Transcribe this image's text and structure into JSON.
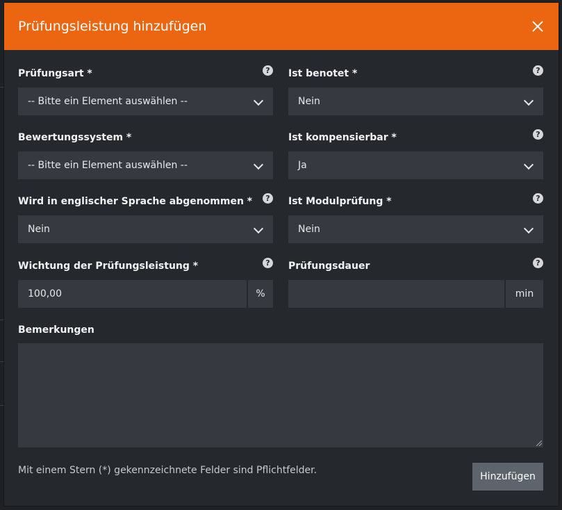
{
  "modal": {
    "title": "Prüfungsleistung hinzufügen",
    "close_icon": "close-icon"
  },
  "fields": {
    "pruefungsart": {
      "label": "Prüfungsart *",
      "value": "-- Bitte ein Element auswählen --"
    },
    "ist_benotet": {
      "label": "Ist benotet *",
      "value": "Nein"
    },
    "bewertungssystem": {
      "label": "Bewertungssystem *",
      "value": "-- Bitte ein Element auswählen --"
    },
    "ist_kompensierbar": {
      "label": "Ist kompensierbar *",
      "value": "Ja"
    },
    "englisch": {
      "label": "Wird in englischer Sprache abgenommen *",
      "value": "Nein"
    },
    "modulpruefung": {
      "label": "Ist Modulprüfung *",
      "value": "Nein"
    },
    "wichtung": {
      "label": "Wichtung der Prüfungsleistung *",
      "value": "100,00",
      "unit": "%"
    },
    "dauer": {
      "label": "Prüfungsdauer",
      "value": "",
      "unit": "min"
    },
    "bemerkungen": {
      "label": "Bemerkungen",
      "value": ""
    }
  },
  "footer": {
    "note": "Mit einem Stern (*) gekennzeichnete Felder sind Pflichtfelder.",
    "submit_label": "Hinzufügen"
  },
  "help_icon_glyph": "?",
  "colors": {
    "header": "#ec6611",
    "modal_bg": "#25282c",
    "control_bg": "#363a40",
    "button_bg": "#5e646b"
  }
}
